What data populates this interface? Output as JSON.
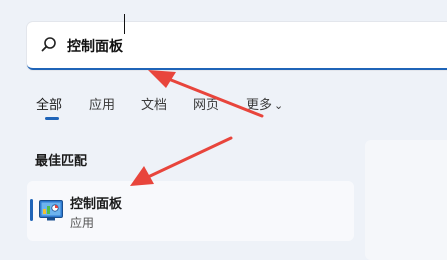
{
  "search": {
    "value": "控制面板",
    "icon": "search-icon"
  },
  "tabs": [
    {
      "label": "全部",
      "active": true
    },
    {
      "label": "应用"
    },
    {
      "label": "文档"
    },
    {
      "label": "网页"
    },
    {
      "label": "更多"
    }
  ],
  "more_chevron": "⌄",
  "best_match": {
    "section_title": "最佳匹配",
    "title": "控制面板",
    "subtitle": "应用",
    "icon": "control-panel-icon"
  },
  "colors": {
    "accent": "#1f64b8",
    "arrow": "#e8453c"
  }
}
